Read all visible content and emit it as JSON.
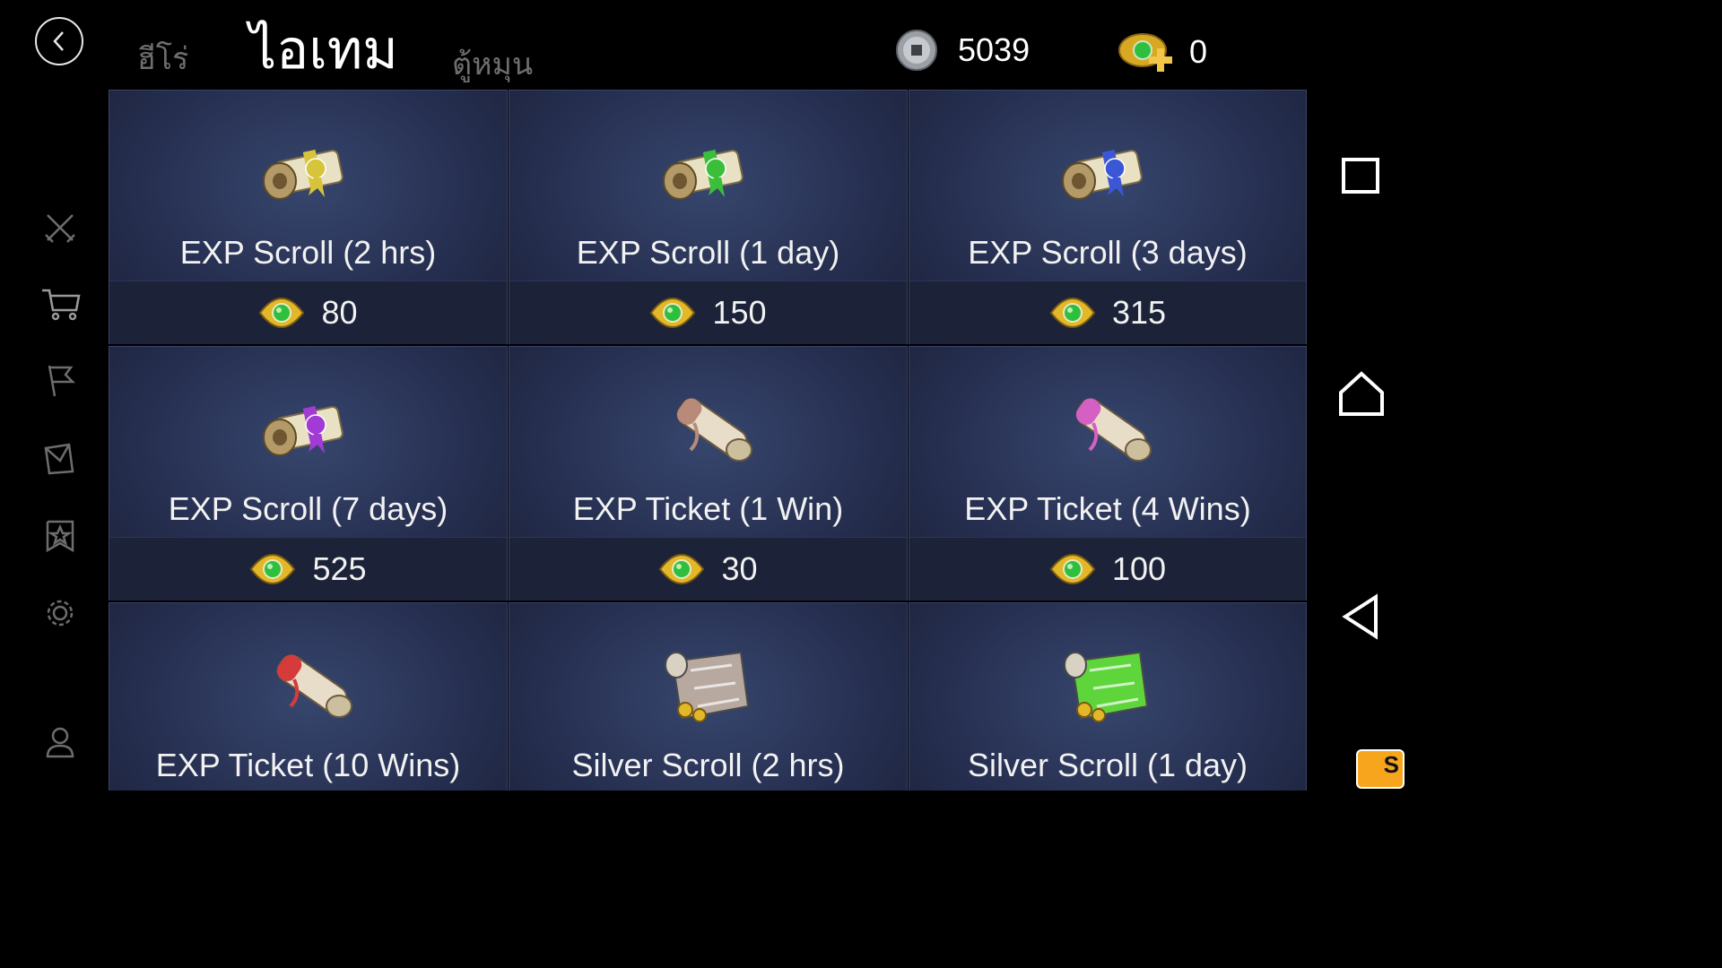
{
  "header": {
    "tabs": [
      {
        "label": "ฮีโร่",
        "active": false
      },
      {
        "label": "ไอเทม",
        "active": true
      },
      {
        "label": "ตู้หมุน",
        "active": false
      }
    ],
    "currencies": {
      "silver": {
        "icon": "silver-coin-icon",
        "value": "5039"
      },
      "ticket": {
        "icon": "ticket-coin-add-icon",
        "value": "0"
      }
    }
  },
  "left_nav": [
    {
      "name": "battle",
      "icon": "crossed-swords-icon"
    },
    {
      "name": "shop",
      "icon": "cart-icon"
    },
    {
      "name": "flag",
      "icon": "flag-icon"
    },
    {
      "name": "mail",
      "icon": "envelope-icon"
    },
    {
      "name": "rank",
      "icon": "star-banner-icon"
    },
    {
      "name": "settings",
      "icon": "gear-icon"
    },
    {
      "name": "profile",
      "icon": "person-icon"
    }
  ],
  "items": [
    {
      "name": "EXP Scroll (2 hrs)",
      "price": "80",
      "art": "scroll",
      "color": "#d6c53a"
    },
    {
      "name": "EXP Scroll (1 day)",
      "price": "150",
      "art": "scroll",
      "color": "#3bbf3b"
    },
    {
      "name": "EXP Scroll (3 days)",
      "price": "315",
      "art": "scroll",
      "color": "#3b57d6"
    },
    {
      "name": "EXP Scroll (7 days)",
      "price": "525",
      "art": "scroll",
      "color": "#a23bd6"
    },
    {
      "name": "EXP Ticket (1 Win)",
      "price": "30",
      "art": "ticket",
      "color": "#b88a7a"
    },
    {
      "name": "EXP Ticket (4 Wins)",
      "price": "100",
      "art": "ticket",
      "color": "#d65fc3"
    },
    {
      "name": "EXP Ticket (10 Wins)",
      "price": "",
      "art": "ticket",
      "color": "#d63b3b"
    },
    {
      "name": "Silver Scroll (2 hrs)",
      "price": "",
      "art": "map",
      "color": "#b8a9a0"
    },
    {
      "name": "Silver Scroll (1 day)",
      "price": "",
      "art": "map",
      "color": "#5ed63b"
    }
  ],
  "colors": {
    "card_bg": "#262f50",
    "price_bar": "#1c2238",
    "coin_gold": "#e3b72a",
    "coin_green": "#2fbf3f"
  }
}
